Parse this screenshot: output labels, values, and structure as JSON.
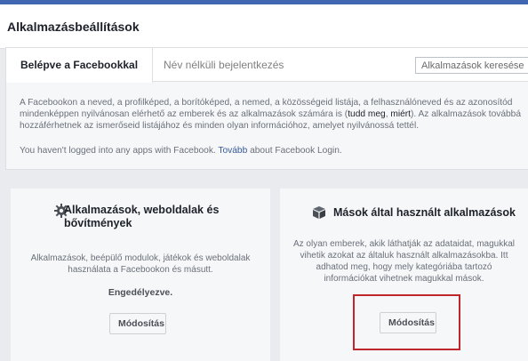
{
  "page": {
    "title": "Alkalmazásbeállítások"
  },
  "tabs": [
    {
      "label": "Belépve a Facebookkal",
      "active": true
    },
    {
      "label": "Név nélküli bejelentkezés",
      "active": false
    }
  ],
  "search": {
    "placeholder": "Alkalmazások keresése"
  },
  "description": {
    "text_before": "A Facebookon a neved, a profilképed, a borítóképed, a nemed, a közösségeid listája, a felhasználóneved és az azonosítód mindenképpen nyilvánosan elérhető az emberek és az alkalmazások számára is (",
    "link1": "tudd meg",
    "sep": ", ",
    "link2": "miért",
    "text_after": "). Az alkalmazások továbbá hozzáférhetnek az ismerőseid listájához és minden olyan információhoz, amelyet nyilvánossá tettél."
  },
  "status": {
    "text_before": "You haven't logged into any apps with Facebook. ",
    "link": "Tovább",
    "text_after": " about Facebook Login."
  },
  "cards": {
    "apps": {
      "icon": "gear-icon",
      "title": "Alkalmazások, weboldalak és bővítmények",
      "text": "Alkalmazások, beépülő modulok, játékok és weboldalak használata a Facebookon és másutt.",
      "status": "Engedélyezve.",
      "button": "Módosítás"
    },
    "others": {
      "icon": "box-icon",
      "title": "Mások által használt alkalmazások",
      "text": "Az olyan emberek, akik láthatják az adataidat, magukkal vihetik azokat az általuk használt alkalmazásokba. Itt adhatod meg, hogy mely kategóriába tartozó információkat vihetnek magukkal mások.",
      "button": "Módosítás"
    }
  },
  "colors": {
    "brand": "#4267b2",
    "link": "#365899",
    "highlight": "#c0272d"
  }
}
